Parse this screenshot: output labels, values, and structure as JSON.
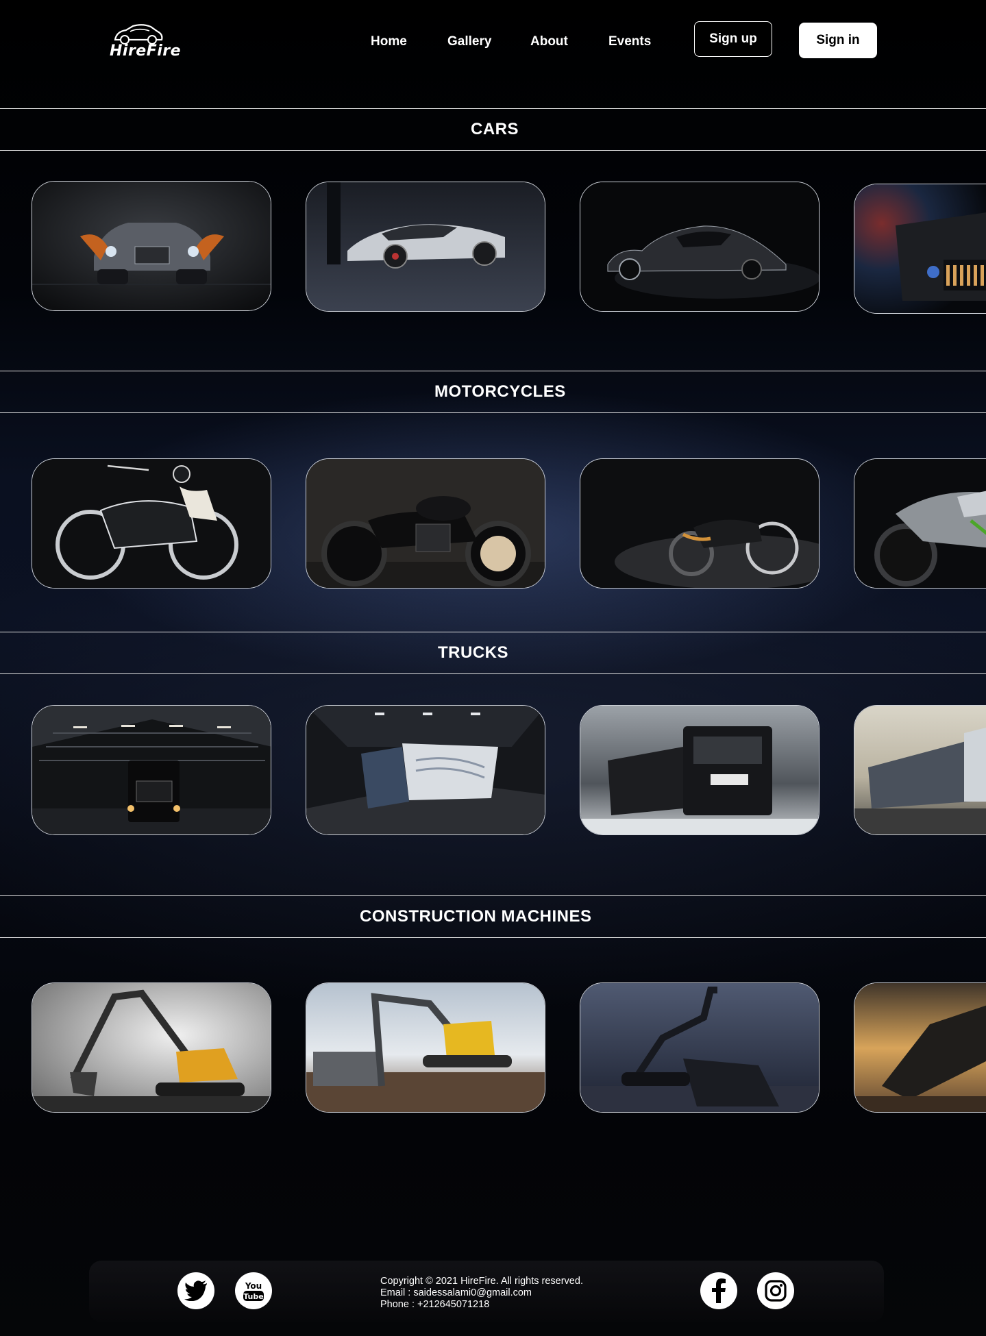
{
  "header": {
    "logo_text": "HireFire",
    "nav": [
      "Home",
      "Gallery",
      "About",
      "Events"
    ],
    "signup_label": "Sign up",
    "signin_label": "Sign in"
  },
  "sections": [
    {
      "title": "CARS",
      "items": [
        "rolls-royce-convertible",
        "bugatti-coupe",
        "vintage-coupe",
        "jeep"
      ]
    },
    {
      "title": "MOTORCYCLES",
      "items": [
        "vintage-bmw-motorcycle",
        "triumph-bobber",
        "cafe-racer",
        "kawasaki-z"
      ]
    },
    {
      "title": "TRUCKS",
      "items": [
        "truck-in-hangar",
        "semi-truck-in-tunnel",
        "iveco-dump-truck",
        "road-train"
      ]
    },
    {
      "title": "CONSTRUCTION MACHINES",
      "items": [
        "excavator-yellow",
        "volvo-excavator",
        "dark-excavator",
        "volvo-excavator-sunset"
      ]
    }
  ],
  "footer": {
    "copyright": "Copyright © 2021 HireFire. All rights reserved.",
    "email": "Email : saidessalami0@gmail.com",
    "phone": "Phone : +212645071218",
    "social_icons": [
      "twitter-icon",
      "youtube-icon",
      "facebook-icon",
      "instagram-icon"
    ]
  },
  "colors": {
    "background": "#000000",
    "text": "#ffffff",
    "signin_bg": "#ffffff"
  }
}
